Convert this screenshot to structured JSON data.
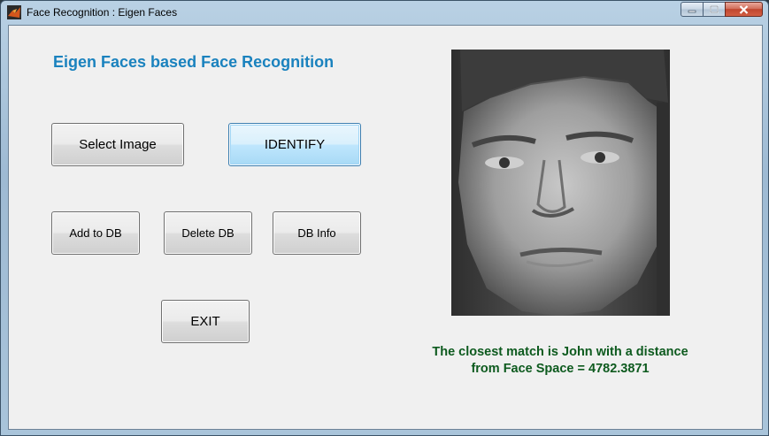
{
  "window": {
    "title": "Face Recognition : Eigen Faces",
    "icon": "matlab-icon",
    "controls": [
      "minimize-icon",
      "maximize-icon",
      "close-icon"
    ]
  },
  "main": {
    "heading": "Eigen Faces based Face Recognition",
    "buttons": {
      "select_image": "Select Image",
      "identify": "IDENTIFY",
      "add_to_db": "Add to DB",
      "delete_db": "Delete DB",
      "db_info": "DB Info",
      "exit": "EXIT"
    },
    "image": "grayscale-face-photo",
    "result_line1": "The closest match is John with a distance",
    "result_line2": "from Face Space = 4782.3871"
  },
  "colors": {
    "heading": "#1a82be",
    "result": "#0d5a1e",
    "client_bg": "#f0f0f0"
  }
}
